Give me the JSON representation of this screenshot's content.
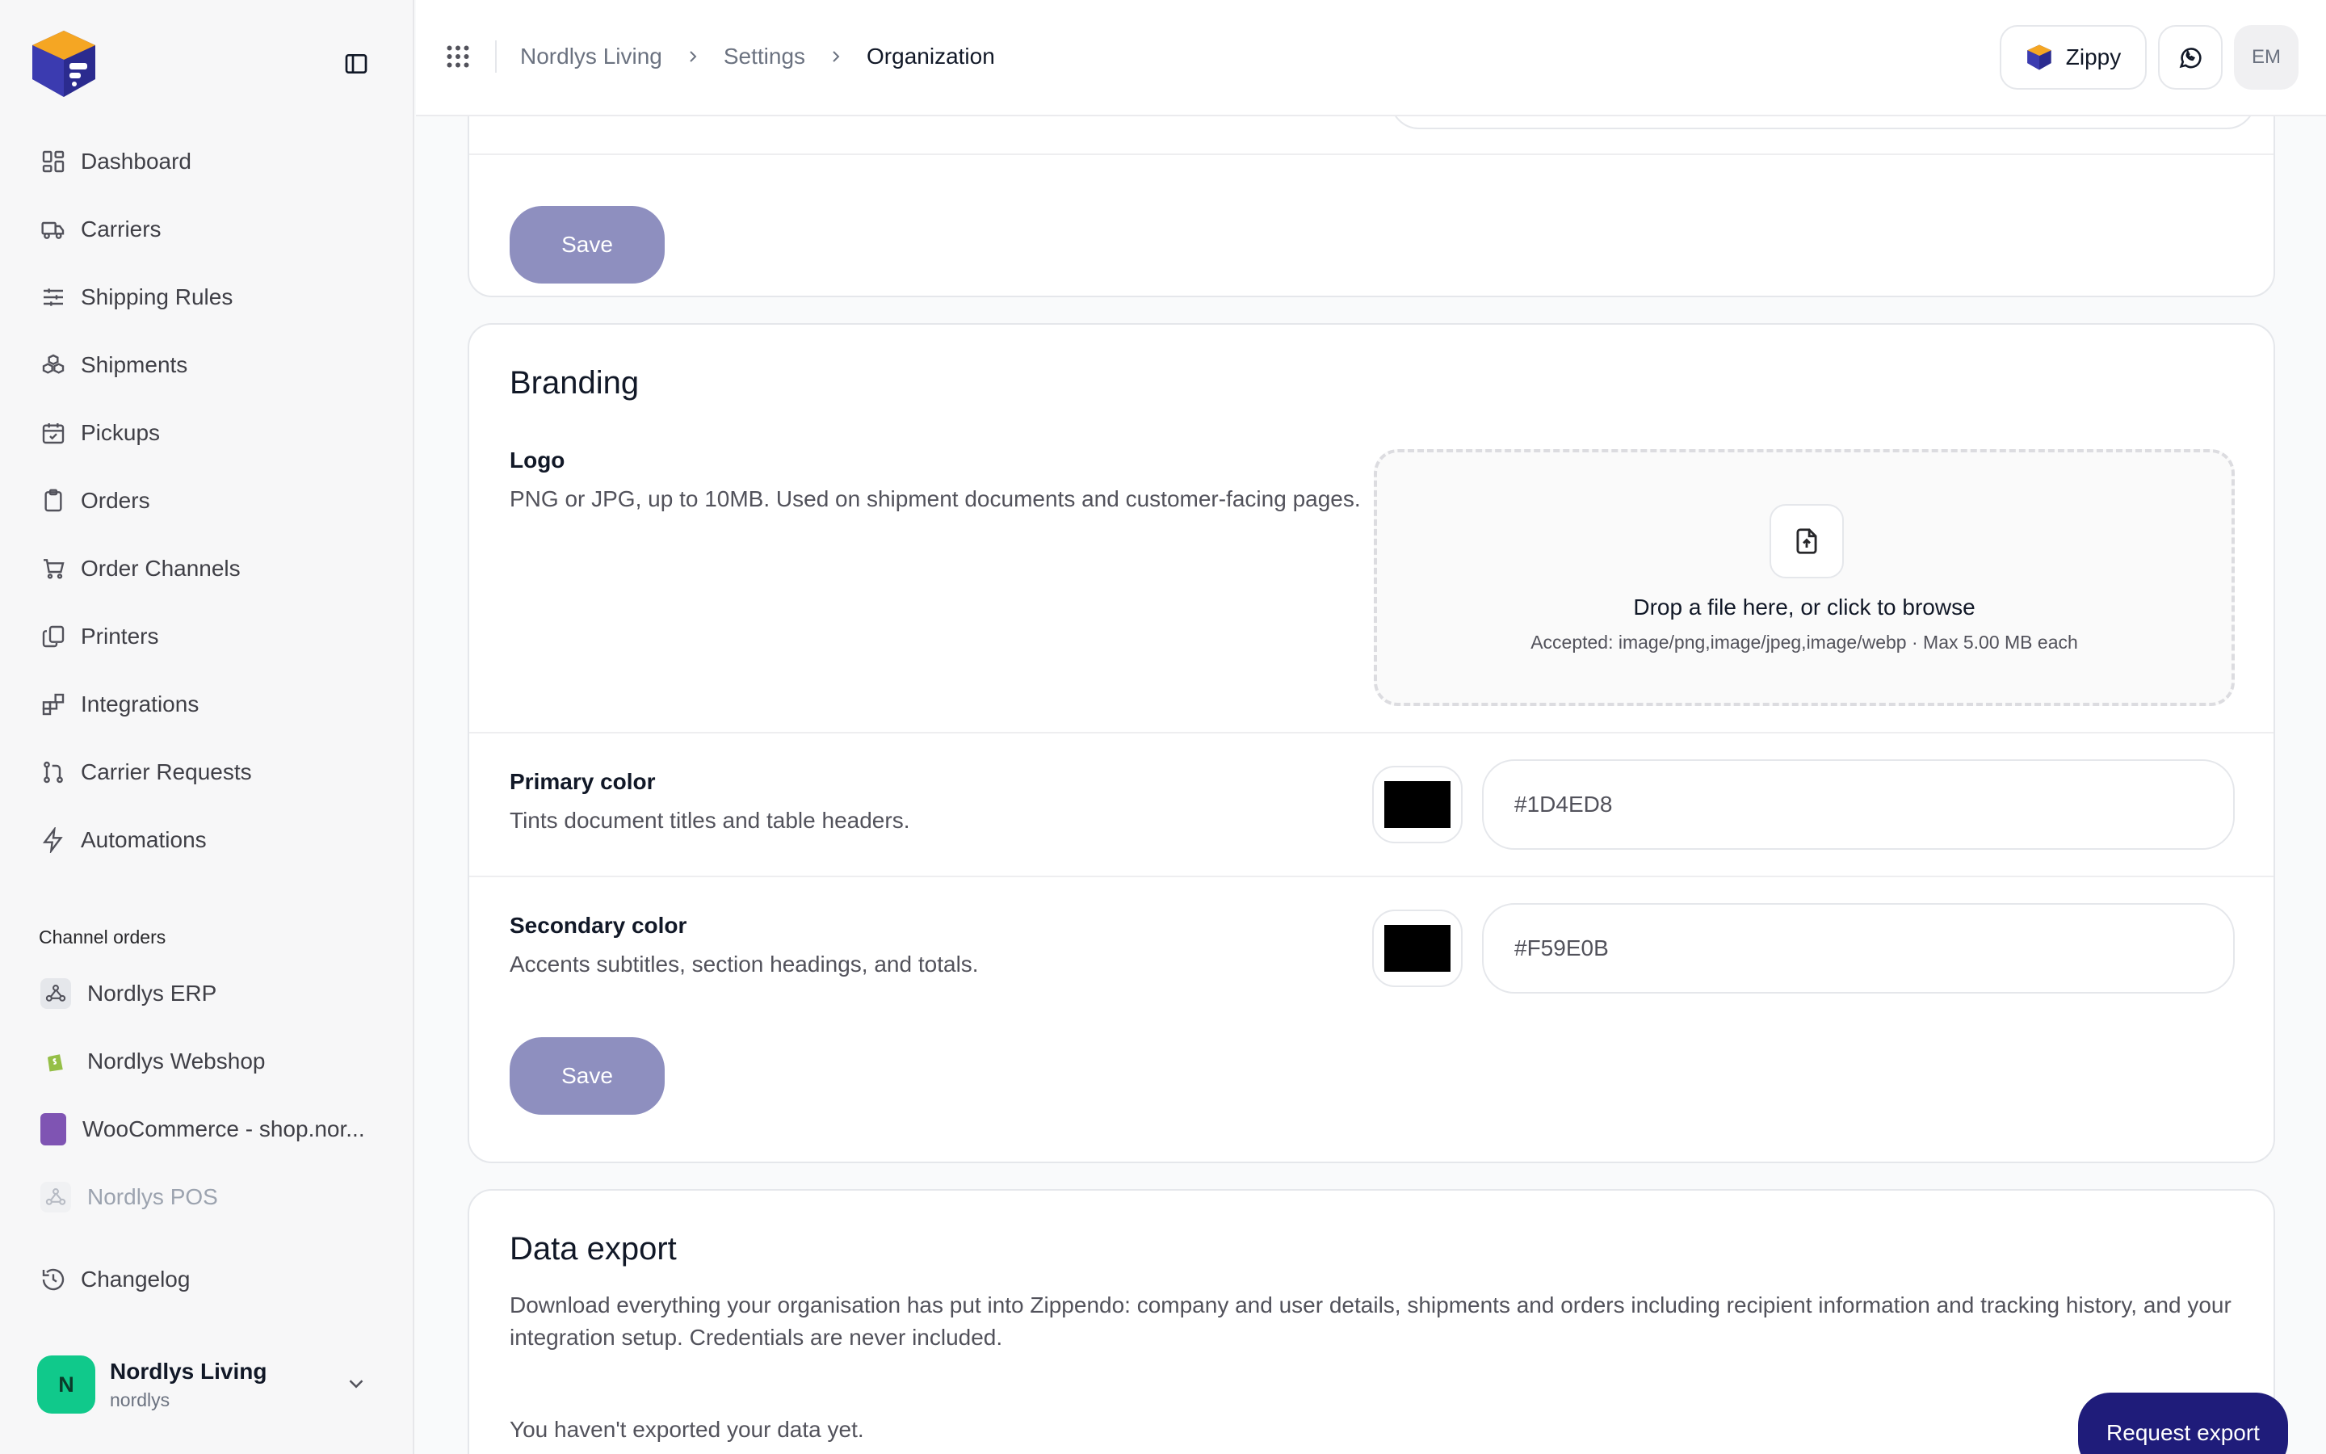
{
  "sidebar": {
    "items": [
      {
        "label": "Dashboard",
        "icon": "dashboard-icon"
      },
      {
        "label": "Carriers",
        "icon": "truck-icon"
      },
      {
        "label": "Shipping Rules",
        "icon": "sliders-icon"
      },
      {
        "label": "Shipments",
        "icon": "boxes-icon"
      },
      {
        "label": "Pickups",
        "icon": "calendar-check-icon"
      },
      {
        "label": "Orders",
        "icon": "clipboard-icon"
      },
      {
        "label": "Order Channels",
        "icon": "cart-icon"
      },
      {
        "label": "Printers",
        "icon": "copy-icon"
      },
      {
        "label": "Integrations",
        "icon": "blocks-icon"
      },
      {
        "label": "Carrier Requests",
        "icon": "git-pull-icon"
      },
      {
        "label": "Automations",
        "icon": "zap-icon"
      }
    ],
    "channels_label": "Channel orders",
    "channels": [
      {
        "label": "Nordlys ERP",
        "icon": "webhook-icon"
      },
      {
        "label": "Nordlys Webshop",
        "icon": "shopify-icon"
      },
      {
        "label": "WooCommerce - shop.nor...",
        "icon": "woocommerce-icon"
      },
      {
        "label": "Nordlys POS",
        "icon": "webhook-icon"
      }
    ],
    "changelog_label": "Changelog",
    "org": {
      "initial": "N",
      "name": "Nordlys Living",
      "handle": "nordlys"
    }
  },
  "topbar": {
    "breadcrumb": [
      "Nordlys Living",
      "Settings",
      "Organization"
    ],
    "zippy_label": "Zippy",
    "user_initials": "EM"
  },
  "main": {
    "save_label": "Save",
    "branding": {
      "title": "Branding",
      "logo_label": "Logo",
      "logo_help": "PNG or JPG, up to 10MB. Used on shipment documents and customer-facing pages.",
      "dropzone_title": "Drop a file here, or click to browse",
      "dropzone_sub": "Accepted: image/png,image/jpeg,image/webp · Max 5.00 MB each",
      "primary_label": "Primary color",
      "primary_help": "Tints document titles and table headers.",
      "primary_value": "#1D4ED8",
      "secondary_label": "Secondary color",
      "secondary_help": "Accents subtitles, section headings, and totals.",
      "secondary_value": "#F59E0B",
      "save_label": "Save"
    },
    "export": {
      "title": "Data export",
      "description": "Download everything your organisation has put into Zippendo: company and user details, shipments and orders including recipient information and tracking history, and your integration setup. Credentials are never included.",
      "status": "You haven't exported your data yet.",
      "button_label": "Request export"
    }
  },
  "colors": {
    "accent": "#1f1c7a",
    "save_button": "#8e8fbf",
    "org_avatar": "#10c98b"
  }
}
